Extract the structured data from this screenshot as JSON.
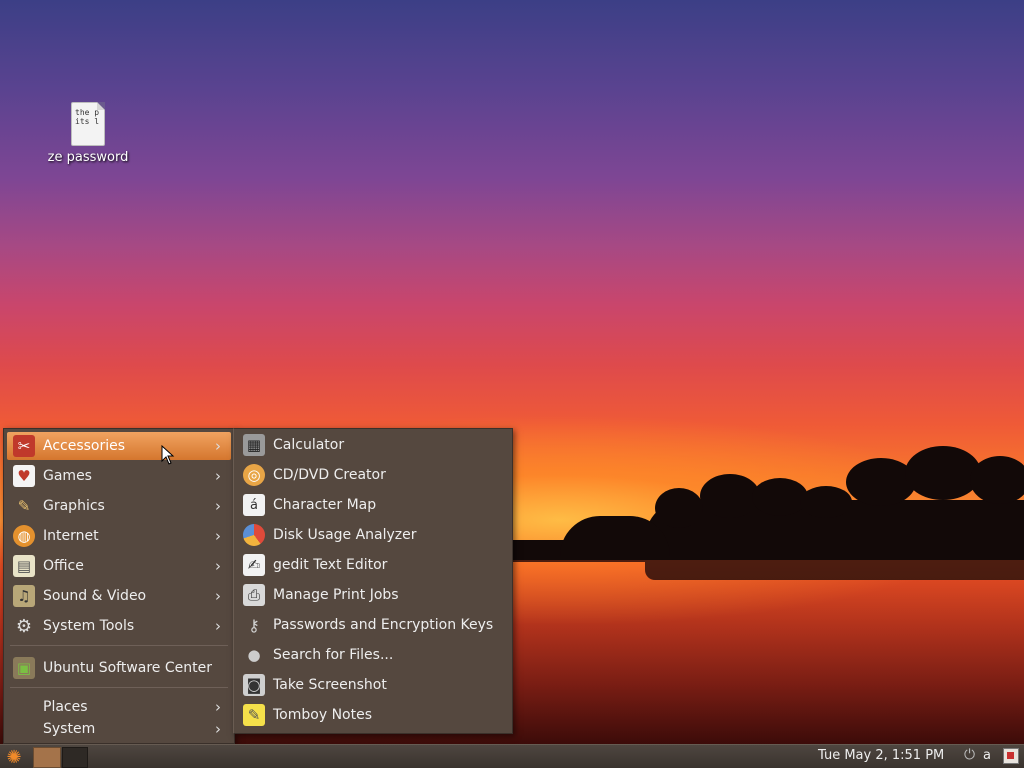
{
  "desktop": {
    "icons": [
      {
        "label": "ze password",
        "preview": "the p\nits l"
      }
    ]
  },
  "main_menu": {
    "items": [
      {
        "label": "Accessories",
        "icon": "accessories-icon",
        "submenu": true,
        "active": true
      },
      {
        "label": "Games",
        "icon": "games-icon",
        "submenu": true
      },
      {
        "label": "Graphics",
        "icon": "graphics-icon",
        "submenu": true
      },
      {
        "label": "Internet",
        "icon": "internet-icon",
        "submenu": true
      },
      {
        "label": "Office",
        "icon": "office-icon",
        "submenu": true
      },
      {
        "label": "Sound & Video",
        "icon": "sound-video-icon",
        "submenu": true
      },
      {
        "label": "System Tools",
        "icon": "system-tools-icon",
        "submenu": true
      },
      {
        "label": "Ubuntu Software Center",
        "icon": "software-center-icon",
        "submenu": false
      },
      {
        "label": "Places",
        "submenu": true
      },
      {
        "label": "System",
        "submenu": true
      }
    ]
  },
  "accessories_menu": {
    "items": [
      {
        "label": "Calculator",
        "icon": "calculator-icon"
      },
      {
        "label": "CD/DVD Creator",
        "icon": "cd-dvd-creator-icon"
      },
      {
        "label": "Character Map",
        "icon": "character-map-icon"
      },
      {
        "label": "Disk Usage Analyzer",
        "icon": "disk-usage-icon"
      },
      {
        "label": "gedit Text Editor",
        "icon": "text-editor-icon"
      },
      {
        "label": "Manage Print Jobs",
        "icon": "printer-icon"
      },
      {
        "label": "Passwords and Encryption Keys",
        "icon": "keys-icon"
      },
      {
        "label": "Search for Files...",
        "icon": "search-icon"
      },
      {
        "label": "Take Screenshot",
        "icon": "camera-icon"
      },
      {
        "label": "Tomboy Notes",
        "icon": "notes-icon"
      }
    ]
  },
  "taskbar": {
    "clock": "Tue May  2,  1:51 PM",
    "user": "a"
  },
  "colors": {
    "menu_bg": "#55483f",
    "highlight": "#e08a45",
    "ubuntu_orange": "#f08a2a"
  }
}
